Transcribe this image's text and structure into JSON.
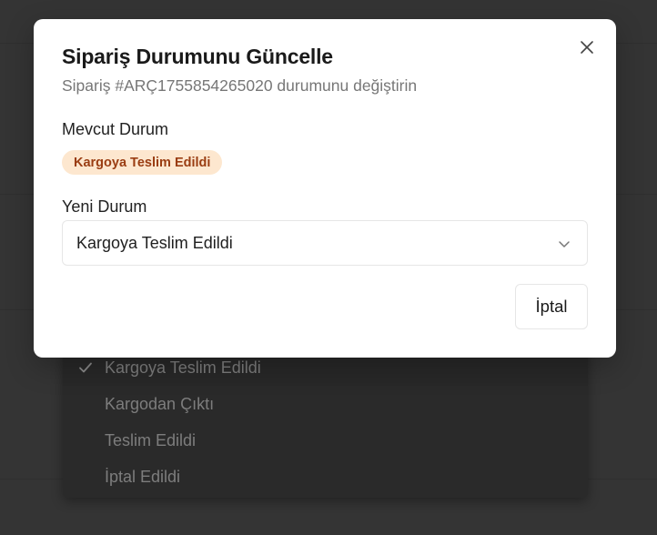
{
  "modal": {
    "title": "Sipariş Durumunu Güncelle",
    "subtitle": "Sipariş #ARÇ1755854265020 durumunu değiştirin",
    "close_icon": "close-icon",
    "current_status": {
      "label": "Mevcut Durum",
      "badge": "Kargoya Teslim Edildi",
      "badge_bg": "#fde7cf",
      "badge_color": "#9a3d12"
    },
    "new_status": {
      "label": "Yeni Durum",
      "selected_value": "Kargoya Teslim Edildi",
      "chevron_icon": "chevron-down-icon"
    },
    "cancel_label": "İptal"
  },
  "dropdown": {
    "options": [
      {
        "label": "Kargoya Teslim Edildi",
        "selected": true
      },
      {
        "label": "Kargodan Çıktı",
        "selected": false
      },
      {
        "label": "Teslim Edildi",
        "selected": false
      },
      {
        "label": "İptal Edildi",
        "selected": false
      }
    ],
    "check_icon": "check-icon"
  }
}
